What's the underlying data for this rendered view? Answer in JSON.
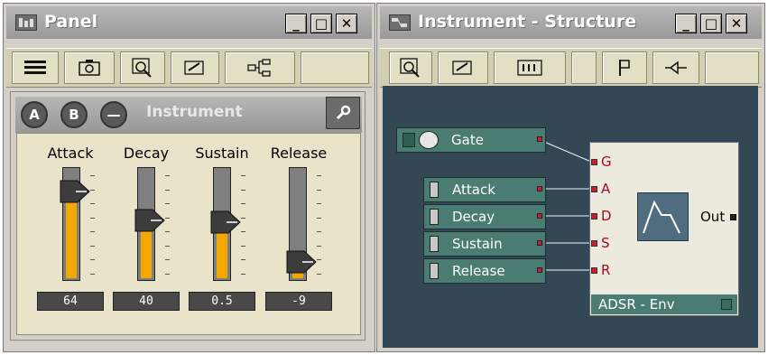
{
  "panel_window": {
    "title": "Panel",
    "tabs": [
      {
        "label": "A"
      },
      {
        "label": "B"
      },
      {
        "label": "—"
      }
    ],
    "instrument_label": "Instrument",
    "sliders": [
      {
        "label": "Attack",
        "value": "64",
        "level": 0.78
      },
      {
        "label": "Decay",
        "value": "40",
        "level": 0.52
      },
      {
        "label": "Sustain",
        "value": "0.5",
        "level": 0.5
      },
      {
        "label": "Release",
        "value": "-9",
        "level": 0.14
      }
    ]
  },
  "structure_window": {
    "title": "Instrument - Structure",
    "modules": [
      {
        "label": "Gate",
        "type": "gate"
      },
      {
        "label": "Attack",
        "type": "fader"
      },
      {
        "label": "Decay",
        "type": "fader"
      },
      {
        "label": "Sustain",
        "type": "fader"
      },
      {
        "label": "Release",
        "type": "fader"
      }
    ],
    "adsr": {
      "inputs": [
        "G",
        "A",
        "D",
        "S",
        "R"
      ],
      "output": "Out",
      "name": "ADSR - Env"
    }
  },
  "window_buttons": {
    "minimize": "_",
    "maximize": "□",
    "close": "✕"
  },
  "colors": {
    "accent": "#f2a800",
    "port": "#d21a2b",
    "module": "#4b7c73",
    "canvas": "#334755"
  }
}
